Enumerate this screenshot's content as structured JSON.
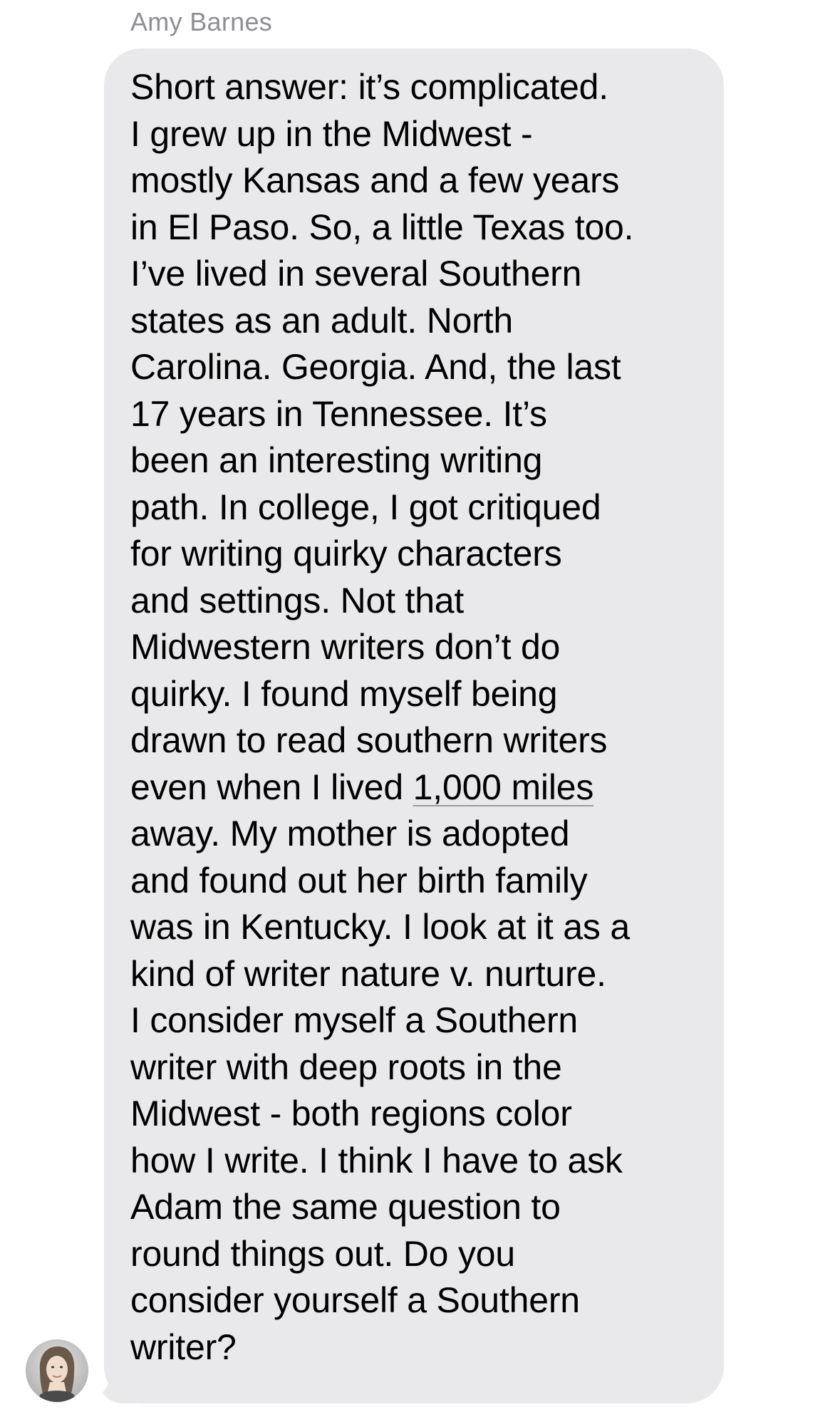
{
  "conversation": {
    "sender_name": "Amy Barnes",
    "message_lines": [
      {
        "text": "Short answer: it’s complicated."
      },
      {
        "text": "I grew up in the Midwest -"
      },
      {
        "text": "mostly Kansas and a few years"
      },
      {
        "text": "in El Paso. So, a little Texas too."
      },
      {
        "text": "I’ve lived in several Southern"
      },
      {
        "text": "states as an adult. North"
      },
      {
        "text": "Carolina. Georgia. And, the last"
      },
      {
        "text": "17 years in Tennessee. It’s"
      },
      {
        "text": "been an interesting writing"
      },
      {
        "text": "path. In college, I got critiqued"
      },
      {
        "text": "for writing quirky characters"
      },
      {
        "text": "and settings. Not that"
      },
      {
        "text": "Midwestern writers don’t do"
      },
      {
        "text": "quirky. I found myself being"
      },
      {
        "text": "drawn to read southern writers"
      },
      {
        "text": "even when I lived ",
        "link": "1,000 miles"
      },
      {
        "text": "away. My mother is adopted"
      },
      {
        "text": "and found out her birth family"
      },
      {
        "text": "was in Kentucky. I look at it as a"
      },
      {
        "text": "kind of writer nature v. nurture."
      },
      {
        "text": "I consider myself a Southern"
      },
      {
        "text": "writer with deep roots in the"
      },
      {
        "text": "Midwest - both regions color"
      },
      {
        "text": "how I write. I think I have to ask"
      },
      {
        "text": "Adam the same question to"
      },
      {
        "text": "round things out. Do you"
      },
      {
        "text": "consider yourself a Southern"
      },
      {
        "text": "writer?"
      }
    ],
    "avatar": {
      "icon": "contact-photo"
    },
    "colors": {
      "bubble": "#e9e9eb",
      "text": "#000000",
      "sender_name": "#8e8e93",
      "background": "#ffffff"
    }
  }
}
